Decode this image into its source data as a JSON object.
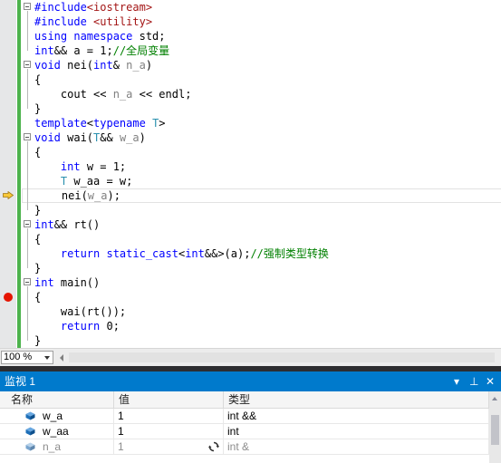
{
  "editor": {
    "lines": [
      [
        {
          "t": "#include",
          "c": "kw"
        },
        {
          "t": "<iostream>",
          "c": "str"
        }
      ],
      [
        {
          "t": "#include ",
          "c": "kw"
        },
        {
          "t": "<utility>",
          "c": "str"
        }
      ],
      [
        {
          "t": "using namespace ",
          "c": "kw"
        },
        {
          "t": "std;",
          "c": ""
        }
      ],
      [
        {
          "t": "int",
          "c": "kw"
        },
        {
          "t": "&& a = 1;",
          "c": ""
        },
        {
          "t": "//全局变量",
          "c": "cm"
        }
      ],
      [
        {
          "t": "void ",
          "c": "kw"
        },
        {
          "t": "nei(",
          "c": ""
        },
        {
          "t": "int",
          "c": "kw"
        },
        {
          "t": "& ",
          "c": ""
        },
        {
          "t": "n_a",
          "c": "par"
        },
        {
          "t": ")",
          "c": ""
        }
      ],
      [
        {
          "t": "{",
          "c": ""
        }
      ],
      [
        {
          "t": "    cout << ",
          "c": ""
        },
        {
          "t": "n_a",
          "c": "par"
        },
        {
          "t": " << endl;",
          "c": ""
        }
      ],
      [
        {
          "t": "}",
          "c": ""
        }
      ],
      [
        {
          "t": "template",
          "c": "kw"
        },
        {
          "t": "<",
          "c": ""
        },
        {
          "t": "typename ",
          "c": "kw"
        },
        {
          "t": "T",
          "c": "tp"
        },
        {
          "t": ">",
          "c": ""
        }
      ],
      [
        {
          "t": "void ",
          "c": "kw"
        },
        {
          "t": "wai(",
          "c": ""
        },
        {
          "t": "T",
          "c": "tp"
        },
        {
          "t": "&& ",
          "c": ""
        },
        {
          "t": "w_a",
          "c": "par"
        },
        {
          "t": ")",
          "c": ""
        }
      ],
      [
        {
          "t": "{",
          "c": ""
        }
      ],
      [
        {
          "t": "    ",
          "c": ""
        },
        {
          "t": "int ",
          "c": "kw"
        },
        {
          "t": "w = 1;",
          "c": ""
        }
      ],
      [
        {
          "t": "    ",
          "c": ""
        },
        {
          "t": "T ",
          "c": "tp"
        },
        {
          "t": "w_aa = w;",
          "c": ""
        }
      ],
      [
        {
          "t": "    nei(",
          "c": ""
        },
        {
          "t": "w_a",
          "c": "par"
        },
        {
          "t": ");",
          "c": ""
        }
      ],
      [
        {
          "t": "}",
          "c": ""
        }
      ],
      [
        {
          "t": "int",
          "c": "kw"
        },
        {
          "t": "&& rt()",
          "c": ""
        }
      ],
      [
        {
          "t": "{",
          "c": ""
        }
      ],
      [
        {
          "t": "    ",
          "c": ""
        },
        {
          "t": "return static_cast",
          "c": "kw"
        },
        {
          "t": "<",
          "c": ""
        },
        {
          "t": "int",
          "c": "kw"
        },
        {
          "t": "&&>(a);",
          "c": ""
        },
        {
          "t": "//强制类型转换",
          "c": "cm"
        }
      ],
      [
        {
          "t": "}",
          "c": ""
        }
      ],
      [
        {
          "t": "int ",
          "c": "kw"
        },
        {
          "t": "main()",
          "c": ""
        }
      ],
      [
        {
          "t": "{",
          "c": ""
        }
      ],
      [
        {
          "t": "    wai(rt());",
          "c": ""
        }
      ],
      [
        {
          "t": "    ",
          "c": ""
        },
        {
          "t": "return ",
          "c": "kw"
        },
        {
          "t": "0;",
          "c": ""
        }
      ],
      [
        {
          "t": "}",
          "c": ""
        }
      ]
    ],
    "fold_lines": [
      0,
      4,
      9,
      15,
      19
    ],
    "current_line": 13,
    "breakpoint_line": 20
  },
  "zoom": {
    "value": "100 %"
  },
  "watch": {
    "title": "监视 1",
    "controls": {
      "dropdown": "▾",
      "pin": "⊥",
      "close": "✕"
    },
    "headers": {
      "name": "名称",
      "value": "值",
      "type": "类型"
    },
    "rows": [
      {
        "name": "w_a",
        "value": "1",
        "type": "int &&",
        "dim": false
      },
      {
        "name": "w_aa",
        "value": "1",
        "type": "int",
        "dim": false
      },
      {
        "name": "n_a",
        "value": "1",
        "type": "int &",
        "dim": true
      }
    ]
  },
  "colors": {
    "accent": "#007acc",
    "changebar": "#4db34d",
    "breakpoint": "#e51400"
  }
}
